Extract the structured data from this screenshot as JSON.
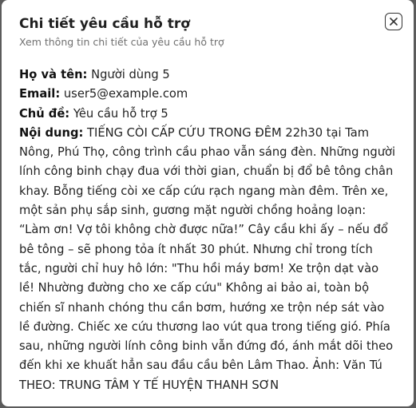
{
  "dialog": {
    "title": "Chi tiết yêu cầu hỗ trợ",
    "subtitle": "Xem thông tin chi tiết của yêu cầu hỗ trợ",
    "close_icon": "close-icon"
  },
  "details": {
    "name_label": "Họ và tên:",
    "name_value": "Người dùng 5",
    "email_label": "Email:",
    "email_value": "user5@example.com",
    "subject_label": "Chủ đề:",
    "subject_value": "Yêu cầu hỗ trợ 5",
    "content_label": "Nội dung:",
    "content_value": "TIẾNG CÒI CẤP CỨU TRONG ĐÊM 22h30 tại Tam Nông, Phú Thọ, công trình cầu phao vẫn sáng đèn. Những người lính công binh chạy đua với thời gian, chuẩn bị đổ bê tông chân khay. Bỗng tiếng còi xe cấp cứu rạch ngang màn đêm. Trên xe, một sản phụ sắp sinh, gương mặt người chồng hoảng loạn: “Làm ơn! Vợ tôi không chờ được nữa!” Cây cầu khi ấy – nếu đổ bê tông – sẽ phong tỏa ít nhất 30 phút. Nhưng chỉ trong tích tắc, người chỉ huy hô lớn: \"Thu hồi máy bơm! Xe trộn dạt vào lề! Nhường đường cho xe cấp cứu\" Không ai bảo ai, toàn bộ chiến sĩ nhanh chóng thu cần bơm, hướng xe trộn nép sát vào lề đường. Chiếc xe cứu thương lao vút qua trong tiếng gió. Phía sau, những người lính công binh vẫn đứng đó, ánh mắt dõi theo đến khi xe khuất hẳn sau đầu cầu bên Lâm Thao. Ảnh: Văn Tú THEO: TRUNG TÂM Y TẾ HUYỆN THANH SƠN"
  }
}
